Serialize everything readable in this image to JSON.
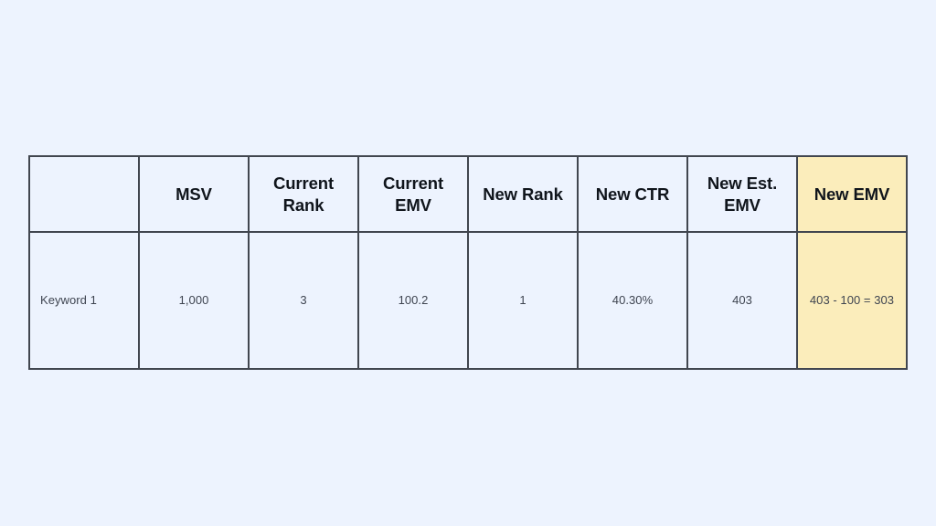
{
  "colors": {
    "page_background": "#edf3fe",
    "cell_background": "#edf3fe",
    "border": "#41464f",
    "highlight": "#fbedbb",
    "header_text": "#10151c",
    "body_text": "#3e4450"
  },
  "table": {
    "headers": [
      "",
      "MSV",
      "Current Rank",
      "Current EMV",
      "New Rank",
      "New CTR",
      "New Est. EMV",
      "New EMV"
    ],
    "highlighted_column_index": 7,
    "rows": [
      {
        "cells": [
          "Keyword 1",
          "1,000",
          "3",
          "100.2",
          "1",
          "40.30%",
          "403",
          "403 - 100 = 303"
        ]
      }
    ]
  }
}
